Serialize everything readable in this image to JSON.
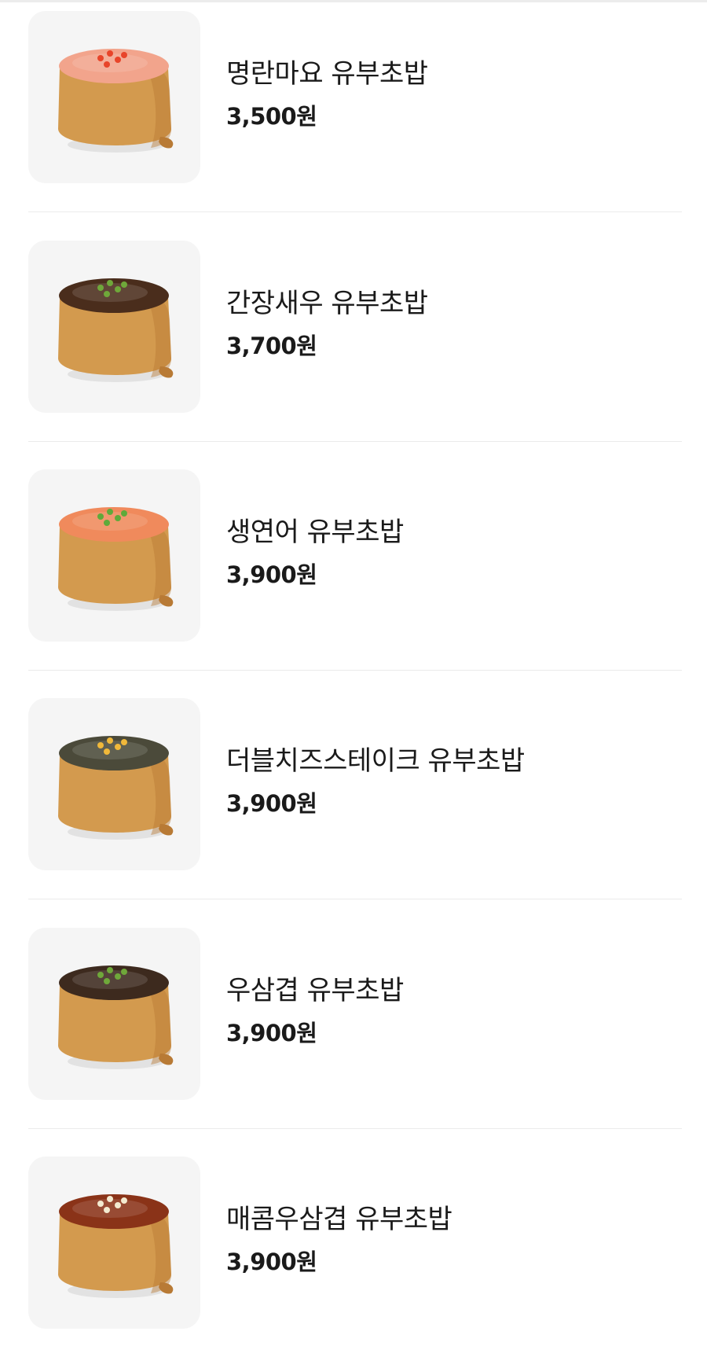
{
  "colors": {
    "thumb_bg": "#f5f5f5",
    "tofu": "#d39a4e",
    "tofu_shadow": "#b87a35",
    "divider": "#ebebeb"
  },
  "menu": {
    "items": [
      {
        "name": "명란마요 유부초밥",
        "price": "3,500원",
        "image_icon": "mentaiko-mayo-inari-icon",
        "topping": "#f2a48c",
        "garnish": "#e8452a"
      },
      {
        "name": "간장새우 유부초밥",
        "price": "3,700원",
        "image_icon": "soy-shrimp-inari-icon",
        "topping": "#4a2d1c",
        "garnish": "#6fa83a"
      },
      {
        "name": "생연어 유부초밥",
        "price": "3,900원",
        "image_icon": "raw-salmon-inari-icon",
        "topping": "#f08a5c",
        "garnish": "#5faa3a"
      },
      {
        "name": "더블치즈스테이크 유부초밥",
        "price": "3,900원",
        "image_icon": "double-cheese-steak-inari-icon",
        "topping": "#4b4a3a",
        "garnish": "#f0b83a"
      },
      {
        "name": "우삼겹 유부초밥",
        "price": "3,900원",
        "image_icon": "beef-brisket-inari-icon",
        "topping": "#3d2a1e",
        "garnish": "#6fa83a"
      },
      {
        "name": "매콤우삼겹 유부초밥",
        "price": "3,900원",
        "image_icon": "spicy-beef-brisket-inari-icon",
        "topping": "#8a3318",
        "garnish": "#f3ead0"
      }
    ]
  }
}
